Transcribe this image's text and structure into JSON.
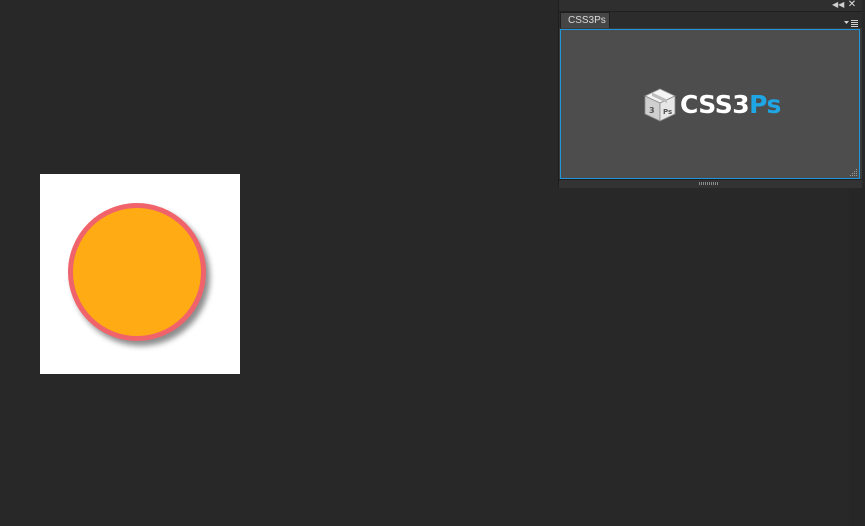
{
  "panel": {
    "tab_label": "CSS3Ps",
    "collapse_icon": "double-chevron-left-icon",
    "close_icon": "close-icon",
    "menu_icon": "panel-menu-icon",
    "accent_border_color": "#2196d6",
    "logo": {
      "text_main": "CSS3",
      "text_accent": "Ps",
      "accent_color": "#1fa6e5",
      "box_label": "Ps"
    }
  },
  "document": {
    "background": "#ffffff",
    "circle": {
      "fill_color": "#ffab14",
      "stroke_color": "#f0636b"
    }
  }
}
